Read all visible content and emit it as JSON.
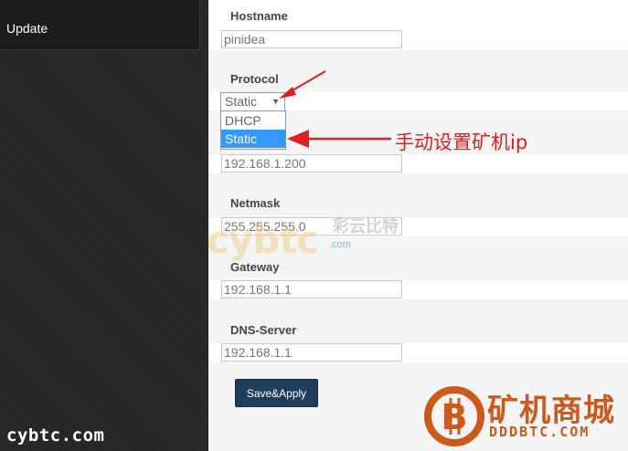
{
  "sidebar": {
    "update_label": "Update",
    "watermark": "cybtc.com"
  },
  "form": {
    "hostname": {
      "label": "Hostname",
      "value": "pinidea"
    },
    "protocol": {
      "label": "Protocol",
      "selected": "Static",
      "options": [
        "DHCP",
        "Static"
      ],
      "highlighted": "Static"
    },
    "ip": {
      "value": "192.168.1.200"
    },
    "netmask": {
      "label": "Netmask",
      "value": "255.255.255.0"
    },
    "gateway": {
      "label": "Gateway",
      "value": "192.168.1.1"
    },
    "dns": {
      "label": "DNS-Server",
      "value": "192.168.1.1"
    },
    "save_label": "Save&Apply"
  },
  "annotation": {
    "text": "手动设置矿机ip",
    "color": "#e02020"
  },
  "watermark": {
    "text": "cybtc",
    "sub": ".com",
    "cn": "彩云比特"
  },
  "logo": {
    "cn": "矿机商城",
    "en": "DDDBTC.COM",
    "color": "#cc5a1a"
  }
}
